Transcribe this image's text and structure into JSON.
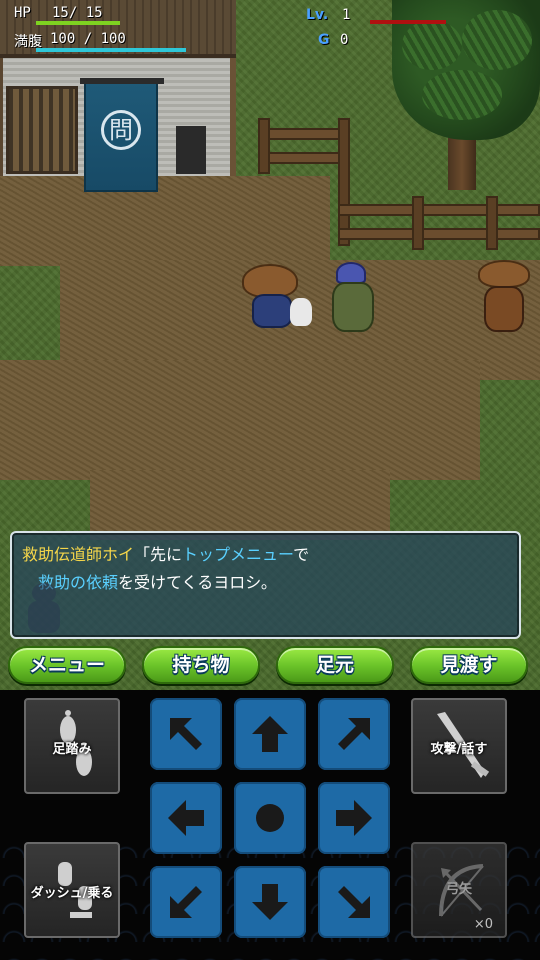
{
  "hud": {
    "hp_label": "HP",
    "hp_value": "15/ 15",
    "hp_fraction": 1.0,
    "hunger_label": "満腹",
    "hunger_value": "100 / 100",
    "hunger_fraction": 1.0,
    "level_label": "Lv.",
    "level_value": "1",
    "gold_label": "G",
    "gold_value": "0",
    "colors": {
      "hp_bar": "#7ed321",
      "hunger_bar": "#2ec7d8",
      "exp_bar": "#b01010"
    }
  },
  "scene": {
    "banner_mark": "問"
  },
  "dialog": {
    "speaker": "救助伝道師ホイ",
    "line1_open": "「先に",
    "line1_highlight": "トップメニュー",
    "line1_close": "で",
    "line2_highlight": "救助の依頼",
    "line2_rest": "を受けてくるヨロシ。",
    "colors": {
      "speaker": "#f5d64a",
      "highlight": "#5ad0ff"
    }
  },
  "commands": {
    "menu": "メニュー",
    "items": "持ち物",
    "feet": "足元",
    "look": "見渡す"
  },
  "controls": {
    "stomp_label": "足踏み",
    "attack_label": "攻撃/話す",
    "dash_label": "ダッシュ/乗る",
    "arrow_label": "弓矢",
    "arrow_count": "×0",
    "dpad_icons": [
      "arrow-up-left-icon",
      "arrow-up-icon",
      "arrow-up-right-icon",
      "arrow-left-icon",
      "wait-dot-icon",
      "arrow-right-icon",
      "arrow-down-left-icon",
      "arrow-down-icon",
      "arrow-down-right-icon"
    ]
  }
}
